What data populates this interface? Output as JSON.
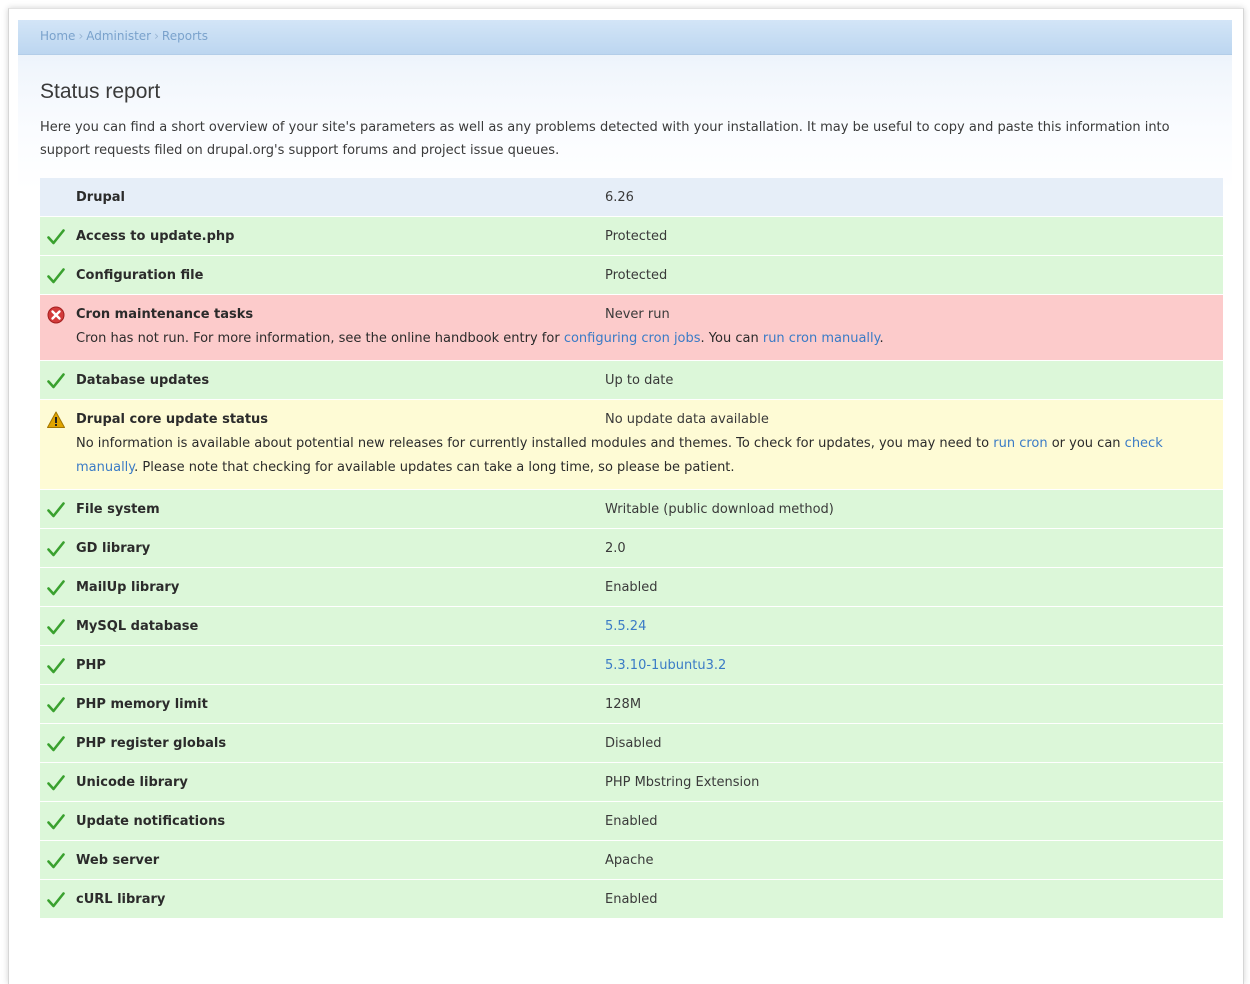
{
  "breadcrumb": [
    "Home",
    "Administer",
    "Reports"
  ],
  "breadcrumb_separator": "›",
  "page_title": "Status report",
  "intro": "Here you can find a short overview of your site's parameters as well as any problems detected with your installation. It may be useful to copy and paste this information into support requests filed on drupal.org's support forums and project issue queues.",
  "colors": {
    "ok_bg": "#dcf7d9",
    "error_bg": "#fccbcb",
    "warning_bg": "#fefbd5",
    "info_bg": "#e6eef8",
    "link": "#3a7bc6",
    "ok_icon": "#3aa12f",
    "error_icon": "#d33b3b",
    "warning_icon": "#e0a400"
  },
  "rows": [
    {
      "severity": "info",
      "title": "Drupal",
      "value": "6.26",
      "icon": ""
    },
    {
      "severity": "ok",
      "title": "Access to update.php",
      "value": "Protected",
      "icon": "check-icon"
    },
    {
      "severity": "ok",
      "title": "Configuration file",
      "value": "Protected",
      "icon": "check-icon"
    },
    {
      "severity": "error",
      "title": "Cron maintenance tasks",
      "value": "Never run",
      "icon": "error-icon",
      "desc_parts": {
        "t1": "Cron has not run. For more information, see the online handbook entry for ",
        "l1": "configuring cron jobs",
        "t2": ". You can ",
        "l2": "run cron manually",
        "t3": "."
      }
    },
    {
      "severity": "ok",
      "title": "Database updates",
      "value": "Up to date",
      "icon": "check-icon"
    },
    {
      "severity": "warning",
      "title": "Drupal core update status",
      "value": "No update data available",
      "icon": "warning-icon",
      "desc_parts": {
        "t1": "No information is available about potential new releases for currently installed modules and themes. To check for updates, you may need to ",
        "l1": "run cron",
        "t2": " or you can ",
        "l2": "check manually",
        "t3": ". Please note that checking for available updates can take a long time, so please be patient."
      }
    },
    {
      "severity": "ok",
      "title": "File system",
      "value": "Writable (public download method)",
      "icon": "check-icon"
    },
    {
      "severity": "ok",
      "title": "GD library",
      "value": "2.0",
      "icon": "check-icon"
    },
    {
      "severity": "ok",
      "title": "MailUp library",
      "value": "Enabled",
      "icon": "check-icon"
    },
    {
      "severity": "ok",
      "title": "MySQL database",
      "value": "5.5.24",
      "icon": "check-icon",
      "value_is_link": true
    },
    {
      "severity": "ok",
      "title": "PHP",
      "value": "5.3.10-1ubuntu3.2",
      "icon": "check-icon",
      "value_is_link": true
    },
    {
      "severity": "ok",
      "title": "PHP memory limit",
      "value": "128M",
      "icon": "check-icon"
    },
    {
      "severity": "ok",
      "title": "PHP register globals",
      "value": "Disabled",
      "icon": "check-icon"
    },
    {
      "severity": "ok",
      "title": "Unicode library",
      "value": "PHP Mbstring Extension",
      "icon": "check-icon"
    },
    {
      "severity": "ok",
      "title": "Update notifications",
      "value": "Enabled",
      "icon": "check-icon"
    },
    {
      "severity": "ok",
      "title": "Web server",
      "value": "Apache",
      "icon": "check-icon"
    },
    {
      "severity": "ok",
      "title": "cURL library",
      "value": "Enabled",
      "icon": "check-icon"
    }
  ]
}
